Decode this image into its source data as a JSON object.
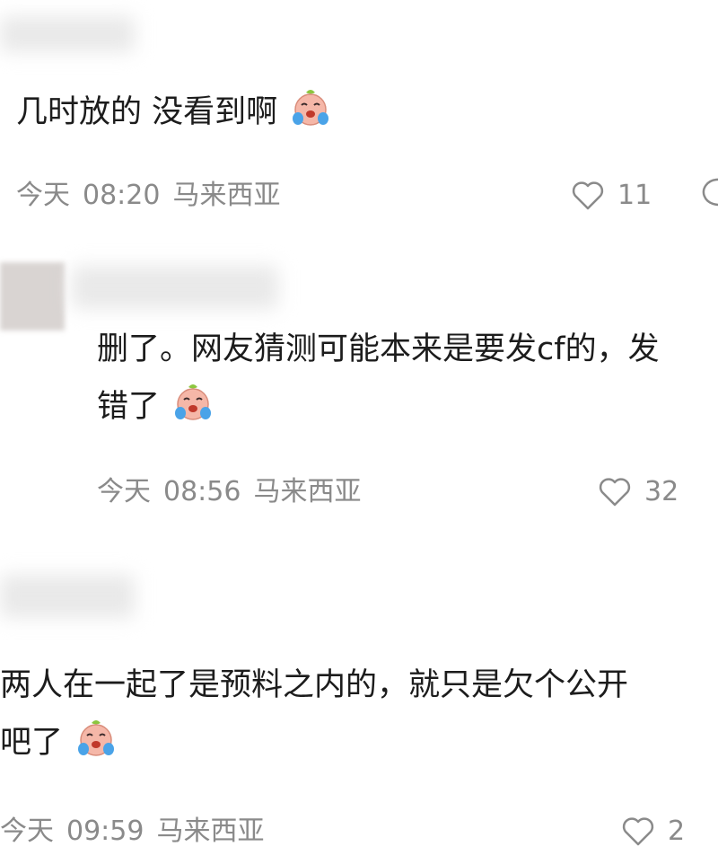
{
  "comments": [
    {
      "text": "几时放的 没看到啊",
      "emoji": "crying-face-icon",
      "date": "今天",
      "time": "08:20",
      "location": "马来西亚",
      "likes": "11"
    },
    {
      "line1": "删了。网友猜测可能本来是要发cf的，发",
      "line2": "错了",
      "emoji": "crying-face-icon",
      "date": "今天",
      "time": "08:56",
      "location": "马来西亚",
      "likes": "32"
    },
    {
      "line1": "两人在一起了是预料之内的，就只是欠个公开",
      "line2": "吧了",
      "emoji": "crying-face-icon",
      "date": "今天",
      "time": "09:59",
      "location": "马来西亚",
      "likes": "2"
    }
  ],
  "colors": {
    "text": "#1c1c1c",
    "meta": "#8a8a8a",
    "background": "#ffffff"
  }
}
